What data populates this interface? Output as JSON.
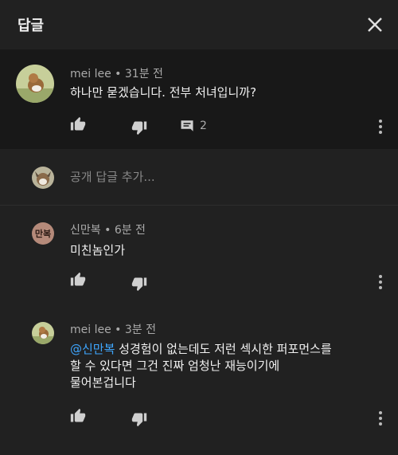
{
  "header": {
    "title": "답글",
    "close_icon": "close-icon"
  },
  "main_comment": {
    "author": "mei lee",
    "time": "31분 전",
    "text": "하나만 묻겠습니다. 전부 처녀입니까?",
    "reply_count": "2"
  },
  "add_reply": {
    "placeholder": "공개 답글 추가..."
  },
  "replies": [
    {
      "author": "신만복",
      "time": "6분 전",
      "avatar_text": "만복",
      "text": "미친놈인가"
    },
    {
      "author": "mei lee",
      "time": "3분 전",
      "mention": "@신만복",
      "text_line1_rest": " 성경험이 없는데도 저런 섹시한 퍼포먼스를",
      "text_line2": "할 수 있다면 그건 진짜 엄청난 재능이기에",
      "text_line3": "물어본겁니다"
    }
  ],
  "colors": {
    "background": "#212121",
    "highlight": "#181818",
    "link": "#3ea6ff",
    "secondary_text": "#aaaaaa"
  }
}
